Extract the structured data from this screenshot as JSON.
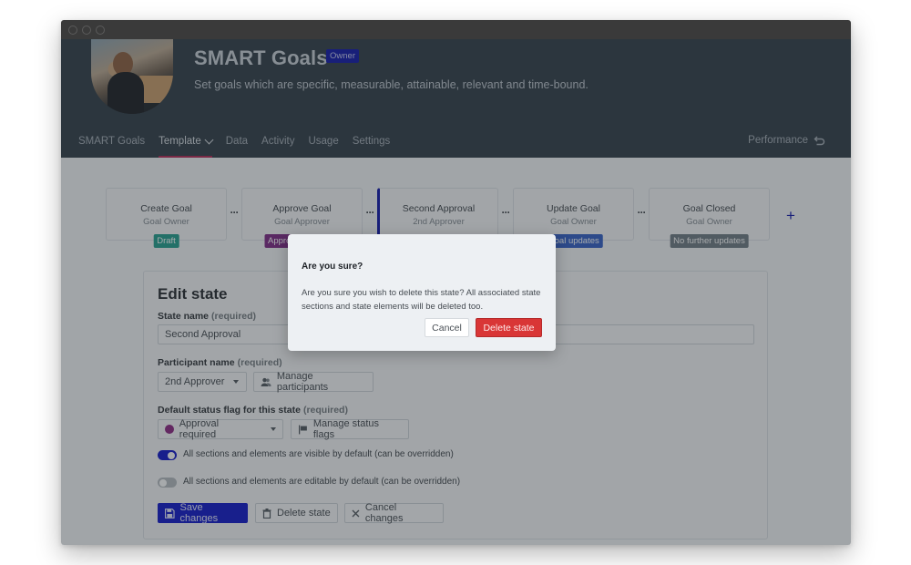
{
  "window": {
    "traffic_lights": [
      "close",
      "minimize",
      "maximize"
    ]
  },
  "header": {
    "title": "SMART Goals",
    "badge": "Owner",
    "subtitle": "Set goals which are specific, measurable, attainable, relevant and time-bound.",
    "avatar_icon": "team-meeting-photo"
  },
  "nav": {
    "items": [
      {
        "label": "SMART Goals",
        "active": false
      },
      {
        "label": "Template",
        "active": true,
        "has_dropdown": true
      },
      {
        "label": "Data",
        "active": false
      },
      {
        "label": "Activity",
        "active": false
      },
      {
        "label": "Usage",
        "active": false
      },
      {
        "label": "Settings",
        "active": false
      }
    ],
    "right_link": {
      "label": "Performance",
      "icon": "undo-arrow-icon"
    }
  },
  "workflow": {
    "steps": [
      {
        "name": "Create Goal",
        "role": "Goal Owner",
        "tag": "Draft",
        "tag_color": "#1d9b8a"
      },
      {
        "name": "Approve Goal",
        "role": "Goal Approver",
        "tag": "Approval required",
        "tag_color": "#7a2282"
      },
      {
        "name": "Second Approval",
        "role": "2nd Approver",
        "tag": "",
        "selected": true
      },
      {
        "name": "Update Goal",
        "role": "Goal Owner",
        "tag": "Goal updates",
        "tag_color": "#2d5bc4"
      },
      {
        "name": "Goal Closed",
        "role": "Goal Owner",
        "tag": "No further updates",
        "tag_color": "#6c7780"
      }
    ],
    "connector_label": "···",
    "add_label": "+"
  },
  "edit_state": {
    "heading": "Edit state",
    "state_name_label": "State name",
    "required_hint": "(required)",
    "state_name_value": "Second Approval",
    "participant_label": "Participant name",
    "participant_value": "2nd Approver",
    "manage_participants": "Manage participants",
    "status_flag_label": "Default status flag for this state",
    "status_flag_value": "Approval required",
    "status_flag_color": "#8a1f7f",
    "manage_status_flags": "Manage status flags",
    "toggle_visible": {
      "label": "All sections and elements are visible by default (can be overridden)",
      "on": true
    },
    "toggle_editable": {
      "label": "All sections and elements are editable by default (can be overridden)",
      "on": false
    },
    "save_label": "Save changes",
    "delete_label": "Delete state",
    "cancel_label": "Cancel changes"
  },
  "modal": {
    "title": "Are you sure?",
    "body": "Are you sure you wish to delete this state? All associated state sections and state elements will be deleted too.",
    "cancel_label": "Cancel",
    "confirm_label": "Delete state"
  },
  "colors": {
    "brand_blue": "#0a11c8",
    "header_bg": "#2c3843",
    "nav_active_underline": "#b0224f",
    "danger": "#d93636"
  }
}
